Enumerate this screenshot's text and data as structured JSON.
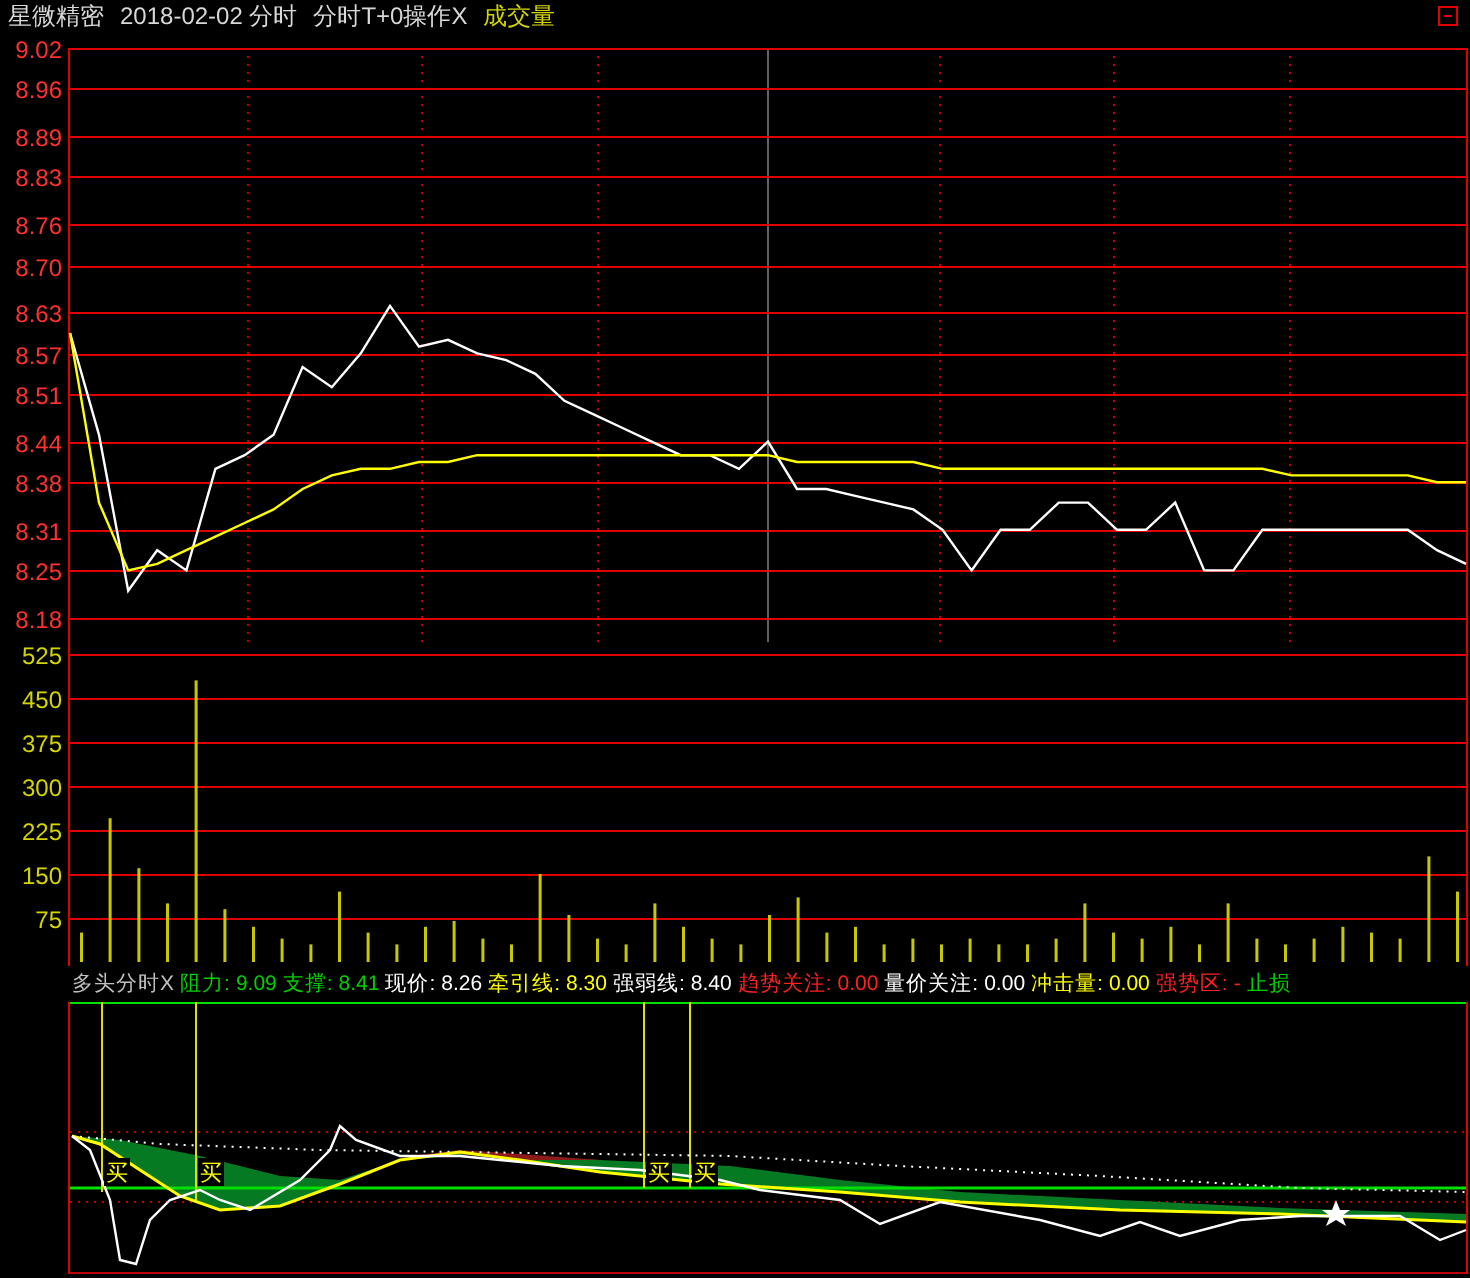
{
  "title_bar": {
    "stock": "星微精密",
    "date_mode": "2018-02-02 分时",
    "indicator": "分时T+0操作X",
    "sub_chart": "成交量"
  },
  "price_chart": {
    "chart_data": {
      "type": "line",
      "grid": true,
      "yticks": [
        {
          "value": 9.02,
          "label": "9.02"
        },
        {
          "value": 8.96,
          "label": "8.96"
        },
        {
          "value": 8.89,
          "label": "8.89"
        },
        {
          "value": 8.83,
          "label": "8.83"
        },
        {
          "value": 8.76,
          "label": "8.76"
        },
        {
          "value": 8.7,
          "label": "8.70"
        },
        {
          "value": 8.63,
          "label": "8.63"
        },
        {
          "value": 8.57,
          "label": "8.57"
        },
        {
          "value": 8.51,
          "label": "8.51"
        },
        {
          "value": 8.44,
          "label": "8.44"
        },
        {
          "value": 8.38,
          "label": "8.38"
        },
        {
          "value": 8.31,
          "label": "8.31"
        },
        {
          "value": 8.25,
          "label": "8.25"
        },
        {
          "value": 8.18,
          "label": "8.18"
        }
      ],
      "ylim": [
        8.18,
        9.02
      ],
      "series": [
        {
          "color": "#ffffff",
          "values": [
            8.6,
            8.45,
            8.22,
            8.28,
            8.25,
            8.4,
            8.42,
            8.45,
            8.55,
            8.52,
            8.57,
            8.64,
            8.58,
            8.59,
            8.57,
            8.56,
            8.54,
            8.5,
            8.48,
            8.46,
            8.44,
            8.42,
            8.42,
            8.4,
            8.44,
            8.37,
            8.37,
            8.36,
            8.35,
            8.34,
            8.31,
            8.25,
            8.31,
            8.31,
            8.35,
            8.35,
            8.31,
            8.31,
            8.35,
            8.25,
            8.25,
            8.31,
            8.31,
            8.31,
            8.31,
            8.31,
            8.31,
            8.28,
            8.26
          ]
        },
        {
          "color": "#ffff00",
          "values": [
            8.6,
            8.35,
            8.25,
            8.26,
            8.28,
            8.3,
            8.32,
            8.34,
            8.37,
            8.39,
            8.4,
            8.4,
            8.41,
            8.41,
            8.42,
            8.42,
            8.42,
            8.42,
            8.42,
            8.42,
            8.42,
            8.42,
            8.42,
            8.42,
            8.42,
            8.41,
            8.41,
            8.41,
            8.41,
            8.41,
            8.4,
            8.4,
            8.4,
            8.4,
            8.4,
            8.4,
            8.4,
            8.4,
            8.4,
            8.4,
            8.4,
            8.4,
            8.39,
            8.39,
            8.39,
            8.39,
            8.39,
            8.38,
            8.38
          ]
        }
      ]
    }
  },
  "volume_chart": {
    "chart_data": {
      "type": "bar",
      "grid": true,
      "yticks": [
        525,
        450,
        375,
        300,
        225,
        150,
        75
      ],
      "ylim": [
        0,
        525
      ],
      "series": [
        {
          "color": "#c8c800",
          "values": [
            50,
            245,
            160,
            100,
            480,
            90,
            60,
            40,
            30,
            120,
            50,
            30,
            60,
            70,
            40,
            30,
            150,
            80,
            40,
            30,
            100,
            60,
            40,
            30,
            80,
            110,
            50,
            60,
            30,
            40,
            30,
            40,
            30,
            30,
            40,
            100,
            50,
            40,
            60,
            30,
            100,
            40,
            30,
            40,
            60,
            50,
            40,
            180,
            120
          ]
        }
      ]
    }
  },
  "indicator_header": [
    {
      "label": "多头分时X",
      "color": "#c0c0c0"
    },
    {
      "label": "阻力:",
      "value": "9.09",
      "color": "#00d000"
    },
    {
      "label": "支撑:",
      "value": "8.41",
      "color": "#00d000"
    },
    {
      "label": "现价:",
      "value": "8.26",
      "color": "#ffffff"
    },
    {
      "label": "牵引线:",
      "value": "8.30",
      "color": "#ffff00"
    },
    {
      "label": "强弱线:",
      "value": "8.40",
      "color": "#ffffff"
    },
    {
      "label": "趋势关注:",
      "value": "0.00",
      "color": "#ff2020"
    },
    {
      "label": "量价关注:",
      "value": "0.00",
      "color": "#ffffff"
    },
    {
      "label": "冲击量:",
      "value": "0.00",
      "color": "#ffff00"
    },
    {
      "label": "强势区:",
      "value": "-",
      "color": "#ff2020"
    },
    {
      "label": "止损",
      "color": "#00d000"
    }
  ],
  "indicator_chart": {
    "buy_marks": [
      "买",
      "买",
      "买",
      "买"
    ]
  }
}
